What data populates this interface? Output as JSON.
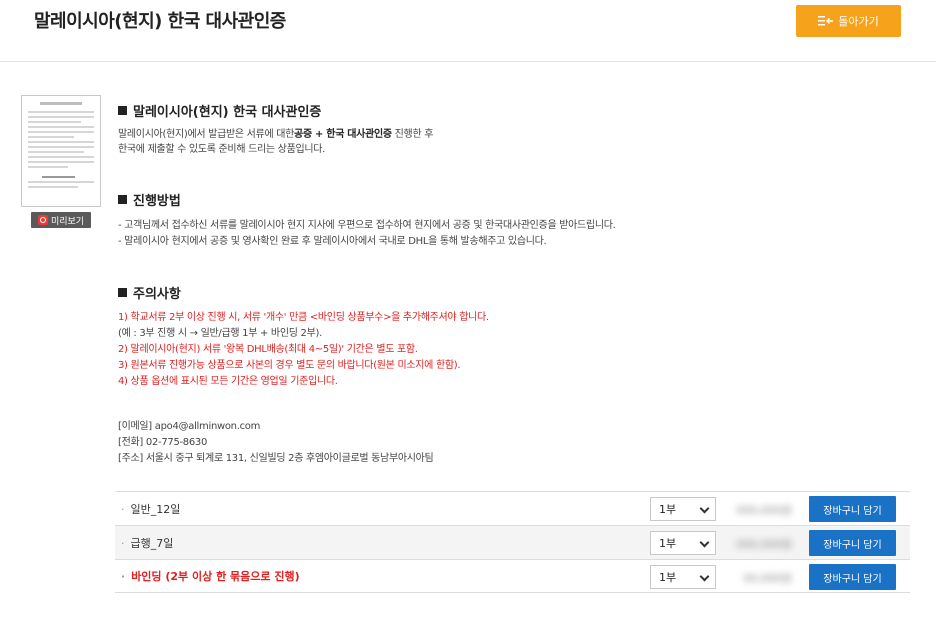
{
  "header": {
    "title": "말레이시아(현지) 한국 대사관인증",
    "back_label": "돌아가기"
  },
  "preview": {
    "label": "미리보기"
  },
  "section1": {
    "heading": "말레이시아(현지) 한국 대사관인증",
    "line1_prefix": "말레이시아(현지)에서 발급받은 서류에 대한",
    "line1_bold": "공증 + 한국 대사관인증",
    "line1_suffix": " 진행한 후",
    "line2": "한국에 제출할 수 있도록 준비해 드리는 상품입니다."
  },
  "section2": {
    "heading": "진행방법",
    "line1": "- 고객님께서 접수하신 서류를 말레이시아 현지 지사에 우편으로 접수하여 현지에서 공증 및 한국대사관인증을 받아드립니다.",
    "line2": "- 말레이시아 현지에서 공증 및 영사확인 완료 후 말레이시아에서 국내로 DHL을 통해 발송해주고 있습니다."
  },
  "section3": {
    "heading": "주의사항",
    "notes": [
      "1) 학교서류 2부 이상 진행 시, 서류 '개수' 만큼 <바인딩 상품부수>을 추가해주셔야 합니다.",
      "(예 : 3부 진행 시 → 일반/급행 1부 + 바인딩 2부).",
      "2) 말레이시아(현지) 서류 '왕복 DHL배송(최대 4~5일)' 기간은 별도 포함.",
      "3) 원본서류 진행가능 상품으로 사본의 경우 별도 문의 바랍니다(원본 미소지에 한함).",
      "4) 상품 옵션에 표시된 모든 기간은 영업일 기준입니다."
    ]
  },
  "contact": {
    "email": "[이메일] apo4@allminwon.com",
    "phone": "[전화] 02-775-8630",
    "address": "[주소] 서울시 중구 퇴계로 131, 신일빌딩 2층 후엠아이글로벌 동남부아시아팀"
  },
  "options": [
    {
      "name": "일반_12일",
      "qty": "1부",
      "price": "000,000원",
      "cart_label": "장바구니 담기"
    },
    {
      "name": "급행_7일",
      "qty": "1부",
      "price": "000,000원",
      "cart_label": "장바구니 담기"
    },
    {
      "name": "바인딩 (2부 이상 한 묶음으로 진행)",
      "qty": "1부",
      "price": "00,000원",
      "cart_label": "장바구니 담기"
    }
  ],
  "colors": {
    "accent": "#f7a21b",
    "cart": "#1a72c6",
    "warning": "#e02020"
  }
}
